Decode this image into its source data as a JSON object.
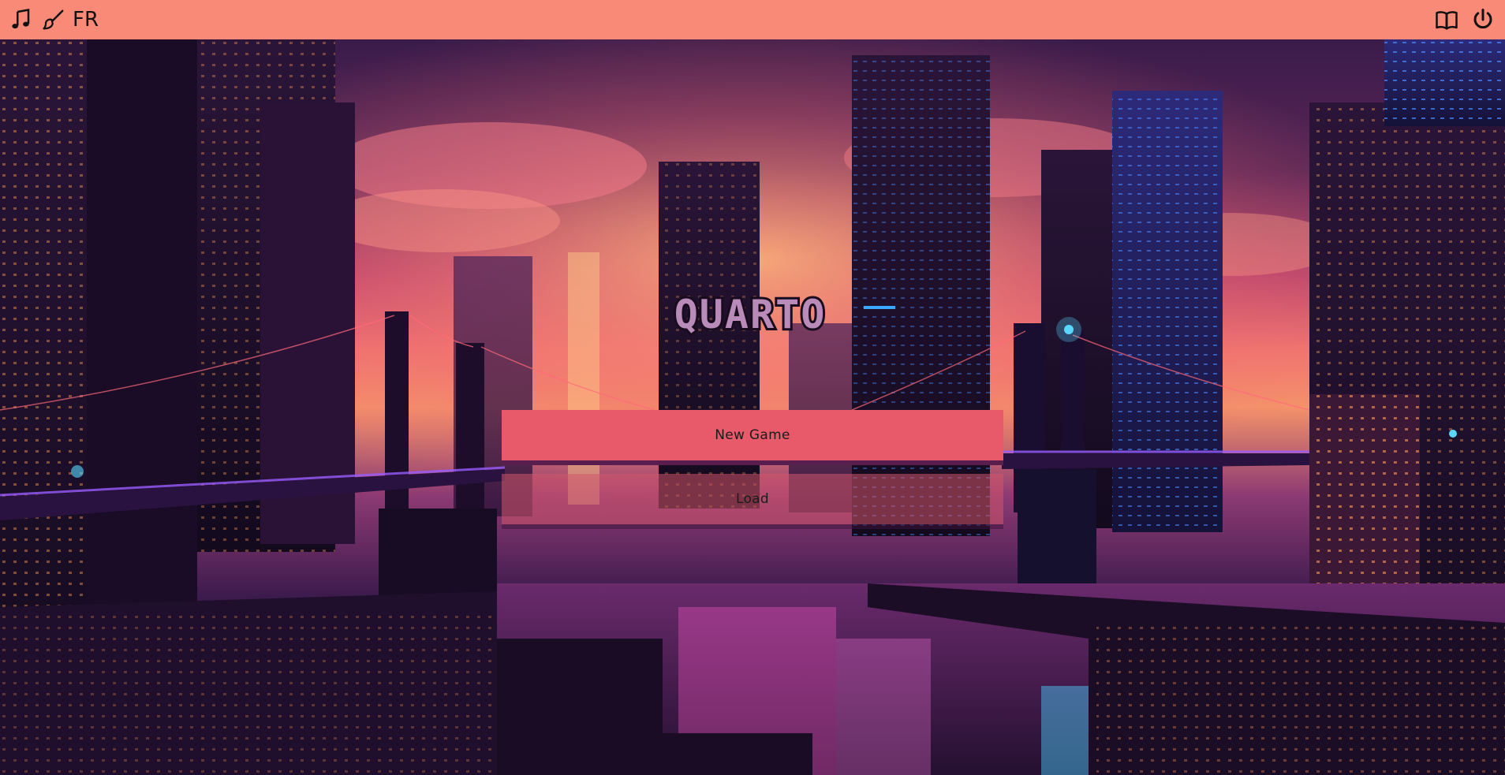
{
  "topbar": {
    "background": "#f98a77",
    "left_icons": [
      "music-note-icon",
      "paintbrush-icon"
    ],
    "language_label": "FR",
    "right_icons": [
      "book-icon",
      "power-icon"
    ]
  },
  "logo": {
    "title": "QUARTO"
  },
  "menu": {
    "new_game_label": "New Game",
    "load_label": "Load"
  },
  "colors": {
    "accent": "#e85a6a",
    "accent_dim": "#d25569",
    "button_shadow": "#5a1e4e"
  }
}
